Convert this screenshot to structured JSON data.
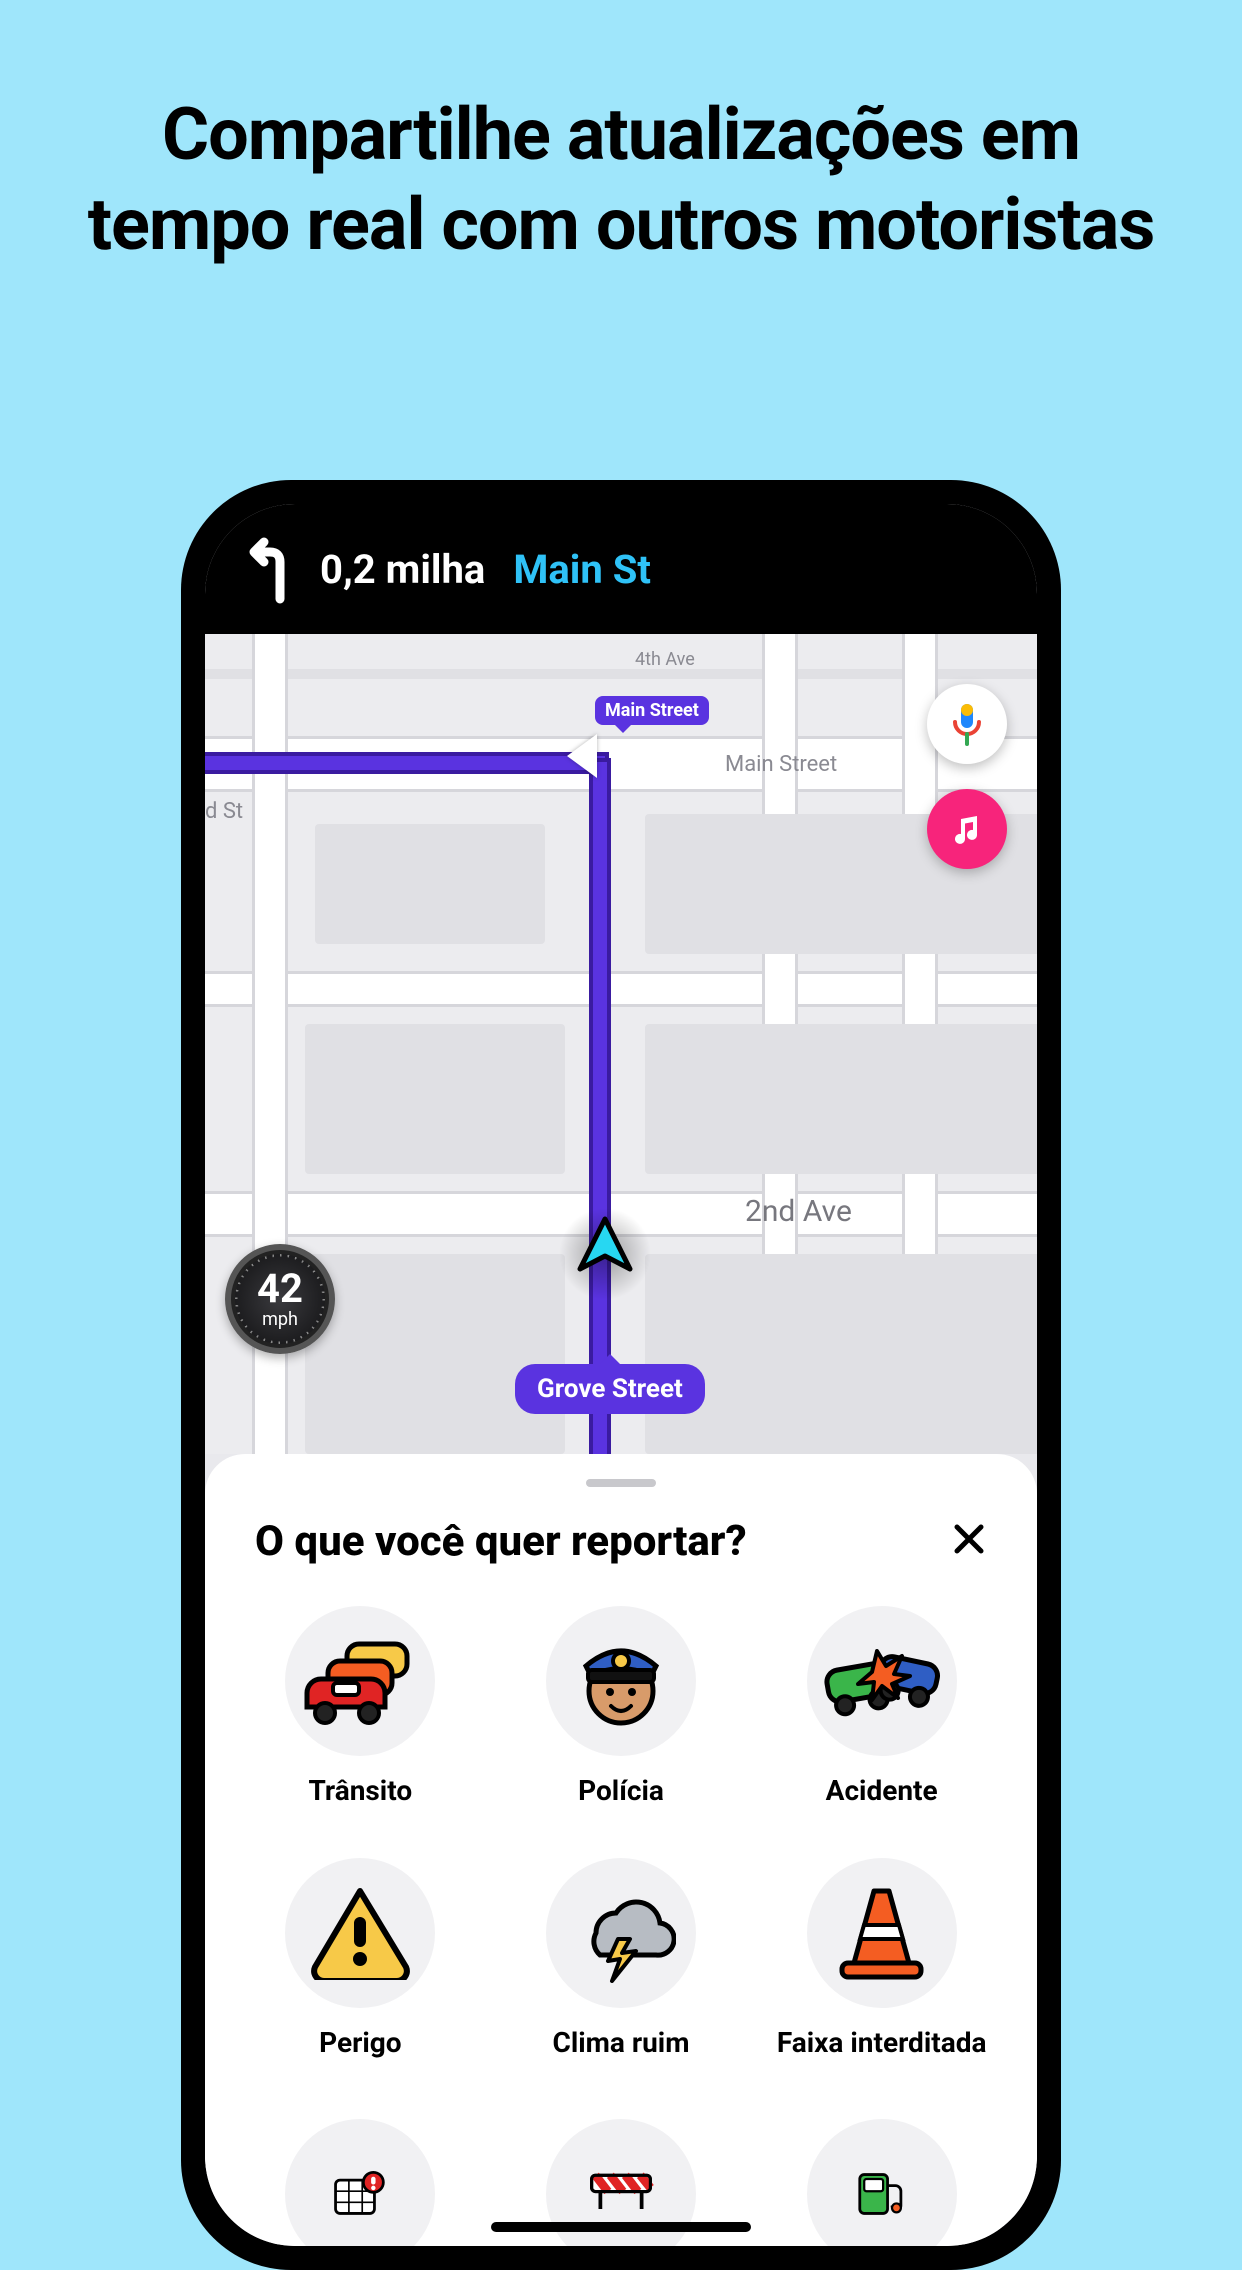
{
  "headline": "Compartilhe atualizações em tempo real com outros motoristas",
  "nav": {
    "distance": "0,2 milha",
    "street": "Main St"
  },
  "map": {
    "labels": {
      "ave4": "4th Ave",
      "main": "Main Street",
      "dst": "d St",
      "ave2": "2nd Ave"
    },
    "routeTag": "Main Street",
    "currentStreet": "Grove Street",
    "speed_value": "42",
    "speed_unit": "mph"
  },
  "sheet": {
    "title": "O que você quer reportar?",
    "items": [
      {
        "label": "Trânsito"
      },
      {
        "label": "Polícia"
      },
      {
        "label": "Acidente"
      },
      {
        "label": "Perigo"
      },
      {
        "label": "Clima ruim"
      },
      {
        "label": "Faixa interditada"
      }
    ]
  }
}
